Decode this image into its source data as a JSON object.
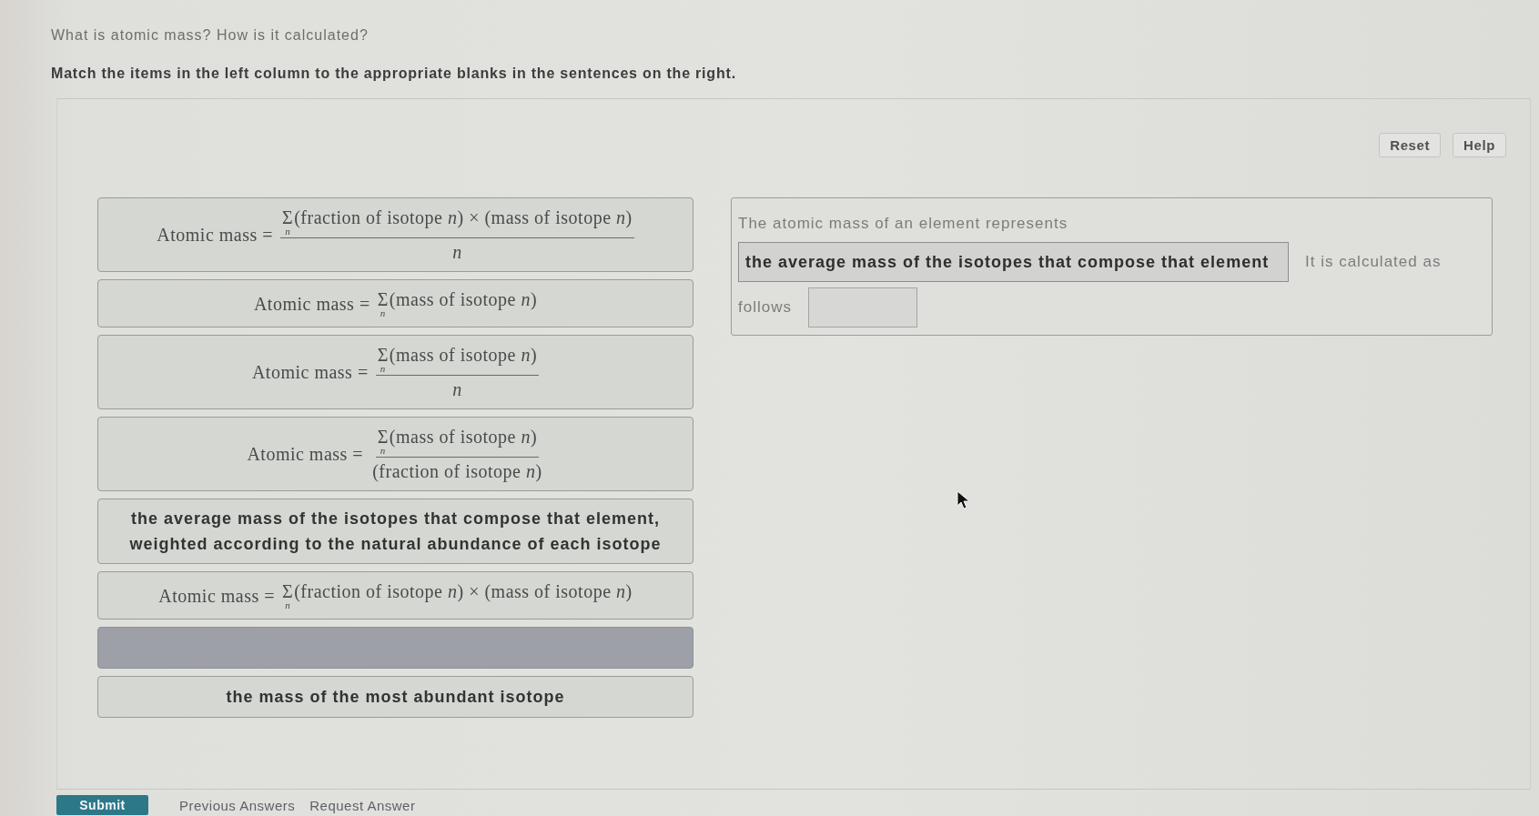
{
  "question": {
    "title": "What is atomic mass? How is it calculated?",
    "instructions": "Match the items in the left column to the appropriate blanks in the sentences on the right."
  },
  "toolbar": {
    "buttons": [
      "Reset",
      "Help"
    ]
  },
  "items": [
    {
      "kind": "fraction",
      "lhs": "Atomic mass =",
      "numerator": {
        "kind": "sum",
        "operator": "Σ",
        "index": "n",
        "body": "(fraction of isotope *n*) × (mass of isotope *n*)"
      },
      "denominator": {
        "kind": "variable",
        "body": "n"
      }
    },
    {
      "kind": "equation",
      "lhs": "Atomic mass =",
      "rhs": {
        "kind": "sum",
        "operator": "Σ",
        "index": "n",
        "body": "(mass of isotope *n*)"
      }
    },
    {
      "kind": "fraction",
      "lhs": "Atomic mass =",
      "numerator": {
        "kind": "sum",
        "operator": "Σ",
        "index": "n",
        "body": "(mass of isotope *n*)"
      },
      "denominator": {
        "kind": "variable",
        "body": "n"
      }
    },
    {
      "kind": "fraction",
      "lhs": "Atomic mass =",
      "numerator": {
        "kind": "sum",
        "operator": "Σ",
        "index": "n",
        "body": "(mass of isotope *n*)"
      },
      "denominator": {
        "kind": "group",
        "body": "(fraction of isotope *n*)"
      }
    },
    {
      "kind": "text",
      "text": "the average mass of the isotopes that compose that element, weighted according to the natural abundance of each isotope"
    },
    {
      "kind": "equation",
      "lhs": "Atomic mass =",
      "rhs": {
        "kind": "sum",
        "operator": "Σ",
        "index": "n",
        "body": "(fraction of isotope *n*) × (mass of isotope *n*)"
      }
    },
    {
      "kind": "vacated"
    },
    {
      "kind": "text",
      "text": "the mass of the most abundant isotope"
    }
  ],
  "sentence": {
    "parts": [
      {
        "kind": "text",
        "text": "The atomic mass of an element represents"
      },
      {
        "kind": "blank",
        "value": "the average mass of the isotopes that compose that element"
      },
      {
        "kind": "text",
        "text": "It is calculated as"
      },
      {
        "kind": "text",
        "text": "follows"
      },
      {
        "kind": "blank"
      }
    ]
  },
  "footer": {
    "submit": "Submit",
    "links": [
      "Previous Answers",
      "Request Answer"
    ]
  }
}
